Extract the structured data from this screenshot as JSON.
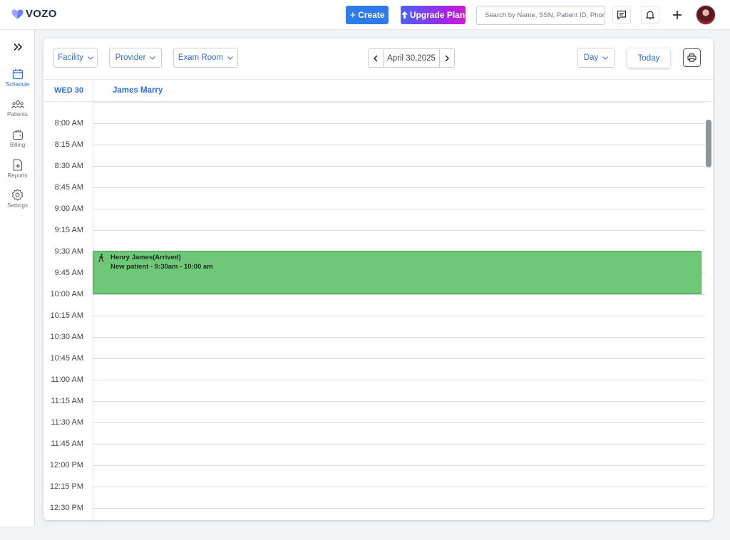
{
  "topbar": {
    "logo_text": "VOZO",
    "create_label": "Create",
    "upgrade_label": "Upgrade Plan",
    "search_placeholder": "Search by Name, SSN, Patient ID, Phone"
  },
  "sidebar": {
    "items": [
      {
        "label": "Schedule",
        "icon": "calendar-icon",
        "active": true
      },
      {
        "label": "Patients",
        "icon": "users-icon"
      },
      {
        "label": "Billing",
        "icon": "wallet-icon"
      },
      {
        "label": "Reports",
        "icon": "report-icon"
      },
      {
        "label": "Settings",
        "icon": "gear-icon"
      }
    ]
  },
  "filters": {
    "facility": "Facility",
    "provider": "Provider",
    "exam_room": "Exam Room",
    "date": "April 30,2025",
    "view": "Day",
    "today": "Today"
  },
  "calendar": {
    "day_label": "WED 30",
    "provider_name": "James Marry",
    "times": [
      "8:00 AM",
      "8:15 AM",
      "8:30 AM",
      "8:45 AM",
      "9:00 AM",
      "9:15 AM",
      "9:30 AM",
      "9:45 AM",
      "10:00 AM",
      "10:15 AM",
      "10:30 AM",
      "10:45 AM",
      "11:00 AM",
      "11:15 AM",
      "11:30 AM",
      "11:45 AM",
      "12:00 PM",
      "12:15 PM",
      "12:30 PM"
    ],
    "appointment": {
      "title": "Henry James(Arrived)",
      "detail": "New patient - 9:30am - 10:00 am",
      "color": "#6fc877"
    }
  },
  "colors": {
    "accent": "#2f7bea",
    "link": "#2f6fd6"
  }
}
